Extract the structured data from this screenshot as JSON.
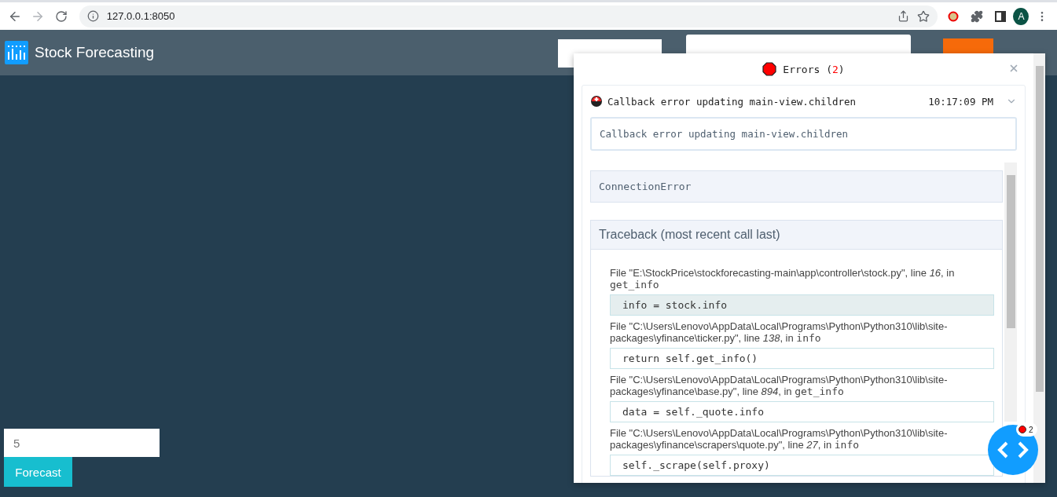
{
  "browser": {
    "url": "127.0.0.1:8050",
    "profile_initial": "A"
  },
  "header": {
    "title": "Stock Forecasting"
  },
  "forecast": {
    "days_value": "5",
    "button": "Forecast"
  },
  "error_overlay": {
    "title": "Errors",
    "count_open": "(",
    "count": "2",
    "count_close": ")",
    "errors": [
      {
        "message": "Callback error updating main-view.children",
        "time": "10:17:09 PM",
        "expanded": true,
        "detail": "Callback error updating main-view.children",
        "exception": "ConnectionError",
        "traceback_title": "Traceback (most recent call last)",
        "frames": [
          {
            "location": "File \"E:\\StockPrice\\stockforecasting-main\\app\\controller\\stock.py\", line *16*, in ",
            "function": "get_info",
            "code": "info = stock.info",
            "highlighted": true
          },
          {
            "location": "File \"C:\\Users\\Lenovo\\AppData\\Local\\Programs\\Python\\Python310\\lib\\site-packages\\yfinance\\ticker.py\", line *138*, in ",
            "function": "info",
            "code": "return self.get_info()",
            "highlighted": false
          },
          {
            "location": "File \"C:\\Users\\Lenovo\\AppData\\Local\\Programs\\Python\\Python310\\lib\\site-packages\\yfinance\\base.py\", line *894*, in ",
            "function": "get_info",
            "code": "data = self._quote.info",
            "highlighted": false
          },
          {
            "location": "File \"C:\\Users\\Lenovo\\AppData\\Local\\Programs\\Python\\Python310\\lib\\site-packages\\yfinance\\scrapers\\quote.py\", line *27*, in ",
            "function": "info",
            "code": "self._scrape(self.proxy)",
            "highlighted": false
          }
        ]
      }
    ]
  },
  "debug_button": {
    "badge_count": "2"
  }
}
